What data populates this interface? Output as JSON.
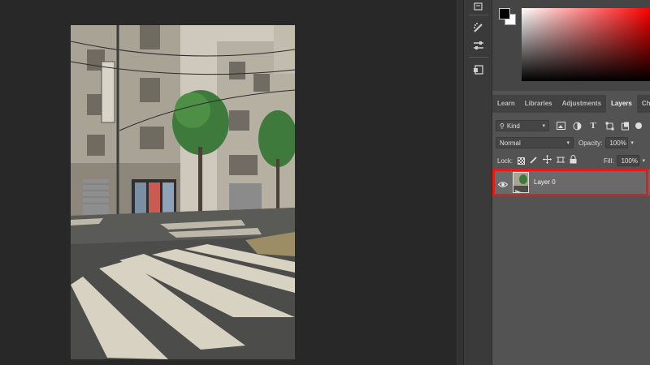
{
  "tool_strip": {
    "icons": [
      "history-icon",
      "brush-settings-icon",
      "adjust-sliders-icon",
      "glyph-icon"
    ]
  },
  "panel_tabs": [
    {
      "label": "Learn",
      "active": false
    },
    {
      "label": "Libraries",
      "active": false
    },
    {
      "label": "Adjustments",
      "active": false
    },
    {
      "label": "Layers",
      "active": true
    },
    {
      "label": "Cha",
      "active": false
    }
  ],
  "layers_panel": {
    "filter_kind": "Kind",
    "blend_mode": "Normal",
    "opacity_label": "Opacity:",
    "opacity_value": "100%",
    "lock_label": "Lock:",
    "fill_label": "Fill:",
    "fill_value": "100%",
    "layers": [
      {
        "name": "Layer 0",
        "visible": true,
        "selected": true
      }
    ]
  },
  "colors": {
    "highlight": "#e21b1b",
    "foreground": "#000000",
    "background": "#ffffff",
    "picker_hue": "#ff0000"
  }
}
